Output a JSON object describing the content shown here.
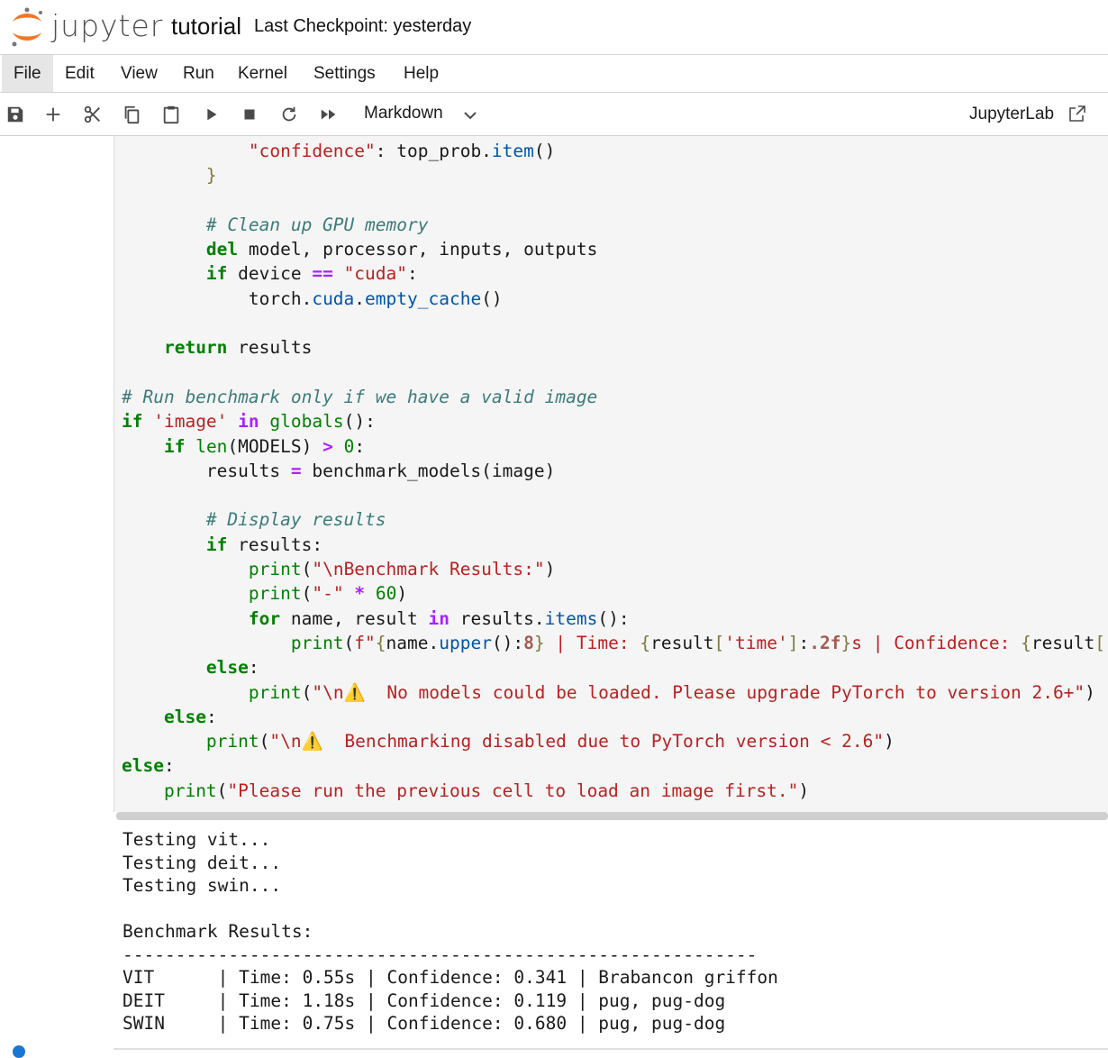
{
  "header": {
    "logo_text": "jupyter",
    "notebook_title": "tutorial",
    "checkpoint": "Last Checkpoint: yesterday"
  },
  "menu": [
    "File",
    "Edit",
    "View",
    "Run",
    "Kernel",
    "Settings",
    "Help"
  ],
  "toolbar": {
    "icons": [
      "save-icon",
      "add-cell-icon",
      "cut-icon",
      "copy-icon",
      "paste-icon",
      "run-icon",
      "stop-icon",
      "restart-icon",
      "run-all-icon"
    ],
    "cell_type": "Markdown",
    "jupyterlab_label": "JupyterLab"
  },
  "colors": {
    "keyword": "#008000",
    "string": "#ba2121",
    "comment": "#3d7b7b",
    "function": "#0055aa",
    "operator": "#aa22ff",
    "cell_bg": "#f5f5f5"
  },
  "output_lines": [
    "Testing vit...",
    "Testing deit...",
    "Testing swin...",
    "",
    "Benchmark Results:",
    "------------------------------------------------------------",
    "VIT      | Time: 0.55s | Confidence: 0.341 | Brabancon griffon",
    "DEIT     | Time: 1.18s | Confidence: 0.119 | pug, pug-dog",
    "SWIN     | Time: 0.75s | Confidence: 0.680 | pug, pug-dog"
  ]
}
